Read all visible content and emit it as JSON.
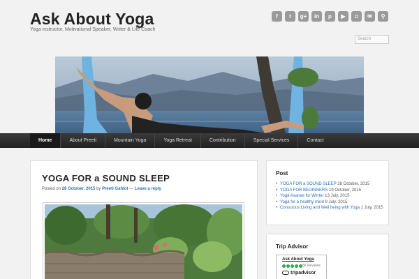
{
  "header": {
    "title": "Ask About Yoga",
    "tagline": "Yoga instructor, Motivational Speaker, Writer & Life Coach"
  },
  "social": [
    {
      "icon": "facebook-icon",
      "glyph": "f"
    },
    {
      "icon": "twitter-icon",
      "glyph": "t"
    },
    {
      "icon": "google-plus-icon",
      "glyph": "g+"
    },
    {
      "icon": "linkedin-icon",
      "glyph": "in"
    },
    {
      "icon": "pinterest-icon",
      "glyph": "p"
    },
    {
      "icon": "youtube-icon",
      "glyph": "▶"
    },
    {
      "icon": "instagram-icon",
      "glyph": "◘"
    },
    {
      "icon": "email-icon",
      "glyph": "✉"
    },
    {
      "icon": "search-icon",
      "glyph": "⚲"
    }
  ],
  "search": {
    "placeholder": "Search"
  },
  "nav": {
    "items": [
      "Home",
      "About Preeti",
      "Mountain Yoga",
      "Yoga Retreat",
      "Contribution",
      "Special Services",
      "Contact"
    ],
    "active": "Home"
  },
  "post": {
    "title": "YOGA FOR a SOUND SLEEP",
    "posted_on": "Posted on",
    "date": "28 October, 2015",
    "by": "by",
    "author": "Preeti Gahlot",
    "separator": "—",
    "reply": "Leave a reply"
  },
  "sidebar": {
    "post_heading": "Post",
    "posts": [
      {
        "title": "YOGA FOR a SOUND SLEEP",
        "date": "28 October, 2015"
      },
      {
        "title": "YOGA FOR BEGINNERS",
        "date": "19 October, 2015"
      },
      {
        "title": "Yoga Asanas for Winter",
        "date": "13 July, 2015"
      },
      {
        "title": "Yoga for a healthy mind",
        "date": "9 July, 2015"
      },
      {
        "title": "Conscious Living and Well being with Yoga",
        "date": "1 July, 2015"
      }
    ],
    "advisor_heading": "Trip Advisor",
    "advisor": {
      "name": "Ask About Yoga",
      "reviews": "56 Reviews",
      "logo": "tripadvisor"
    }
  },
  "colors": {
    "nav_bg": "#2b2b2b",
    "link": "#2a6ebb",
    "icon_bg": "#9a9a9a"
  }
}
